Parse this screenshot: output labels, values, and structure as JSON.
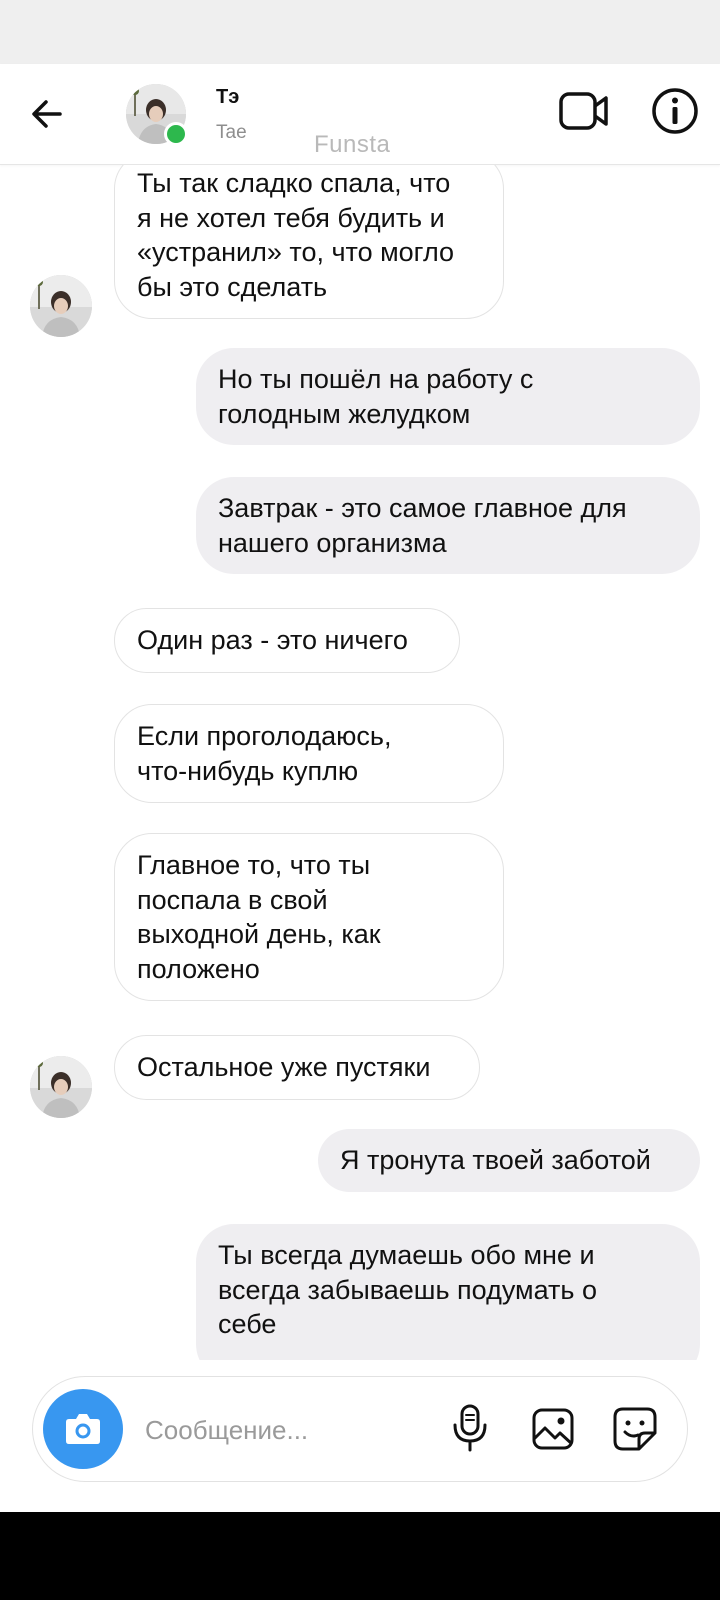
{
  "header": {
    "contact_name": "Тэ",
    "contact_username": "Tae",
    "watermark": "Funsta",
    "back_icon": "arrow-left-icon",
    "video_icon": "video-camera-icon",
    "info_icon": "info-icon",
    "online_color": "#2db84d"
  },
  "messages": [
    {
      "side": "in",
      "text": "Ты так сладко спала, что\nя не хотел тебя будить и\n«устранил» то, что могло\nбы это сделать"
    },
    {
      "side": "out",
      "text": "Но ты пошёл на работу с\nголодным желудком"
    },
    {
      "side": "out",
      "text": "Завтрак - это самое главное для\nнашего организма"
    },
    {
      "side": "in",
      "text": "Один раз - это ничего"
    },
    {
      "side": "in",
      "text": "Если проголодаюсь,\nчто-нибудь куплю"
    },
    {
      "side": "in",
      "text": "Главное то, что ты\nпоспала в свой\nвыходной день, как\nположено"
    },
    {
      "side": "in",
      "text": "Остальное уже пустяки"
    },
    {
      "side": "out",
      "text": "Я тронута твоей заботой"
    },
    {
      "side": "out",
      "text": "Ты всегда думаешь обо мне и\nвсегда забываешь подумать о\nсебе"
    }
  ],
  "composer": {
    "placeholder": "Сообщение...",
    "camera_icon": "camera-icon",
    "mic_icon": "microphone-icon",
    "gallery_icon": "image-icon",
    "sticker_icon": "sticker-icon",
    "accent_color": "#3897f0"
  },
  "colors": {
    "incoming_bubble": "#ffffff",
    "outgoing_bubble": "#efeef1"
  }
}
